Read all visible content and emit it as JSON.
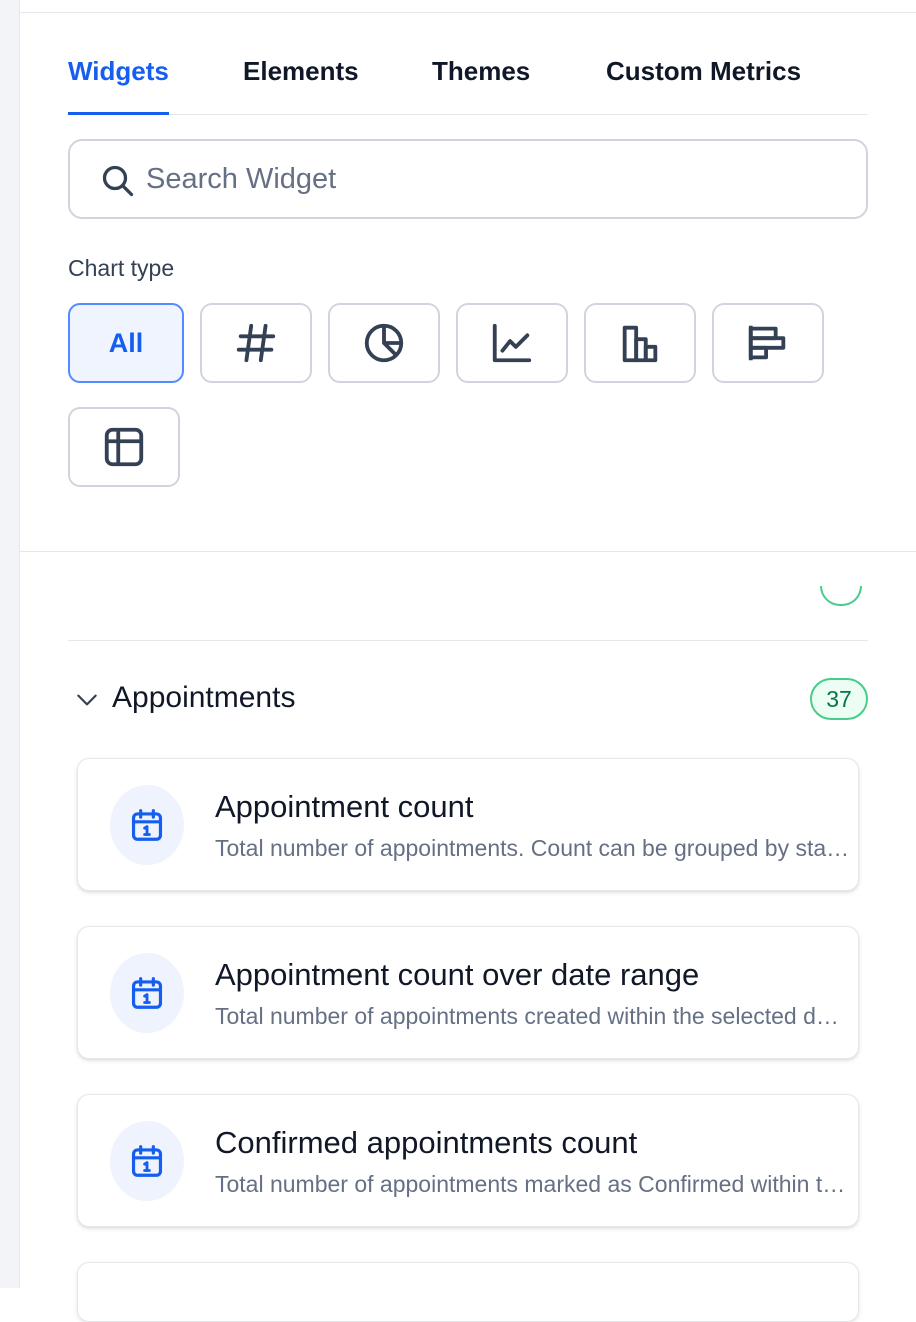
{
  "tabs": [
    {
      "label": "Widgets",
      "active": true
    },
    {
      "label": "Elements",
      "active": false
    },
    {
      "label": "Themes",
      "active": false
    },
    {
      "label": "Custom Metrics",
      "active": false
    }
  ],
  "search": {
    "placeholder": "Search Widget",
    "value": "",
    "icon": "search-icon"
  },
  "chart_type": {
    "label": "Chart type",
    "options": [
      {
        "label": "All",
        "icon": null,
        "selected": true
      },
      {
        "label": "",
        "icon": "hash-icon",
        "selected": false
      },
      {
        "label": "",
        "icon": "pie-chart-icon",
        "selected": false
      },
      {
        "label": "",
        "icon": "line-chart-icon",
        "selected": false
      },
      {
        "label": "",
        "icon": "bar-chart-icon",
        "selected": false
      },
      {
        "label": "",
        "icon": "horizontal-bar-chart-icon",
        "selected": false
      },
      {
        "label": "",
        "icon": "table-icon",
        "selected": false
      }
    ]
  },
  "groups": [
    {
      "title": "Appointments",
      "count": "37",
      "expanded": true,
      "widgets": [
        {
          "title": "Appointment count",
          "description": "Total number of appointments. Count can be grouped by status",
          "icon": "calendar-icon"
        },
        {
          "title": "Appointment count over date range",
          "description": "Total number of appointments created within the selected date range",
          "icon": "calendar-icon"
        },
        {
          "title": "Confirmed appointments count",
          "description": "Total number of appointments marked as Confirmed within the selected date range",
          "icon": "calendar-icon"
        }
      ]
    }
  ],
  "colors": {
    "accent": "#155eef",
    "accent_bg": "#eff4ff",
    "badge_green": "#47cd89",
    "text_primary": "#101828",
    "text_secondary": "#667085"
  }
}
